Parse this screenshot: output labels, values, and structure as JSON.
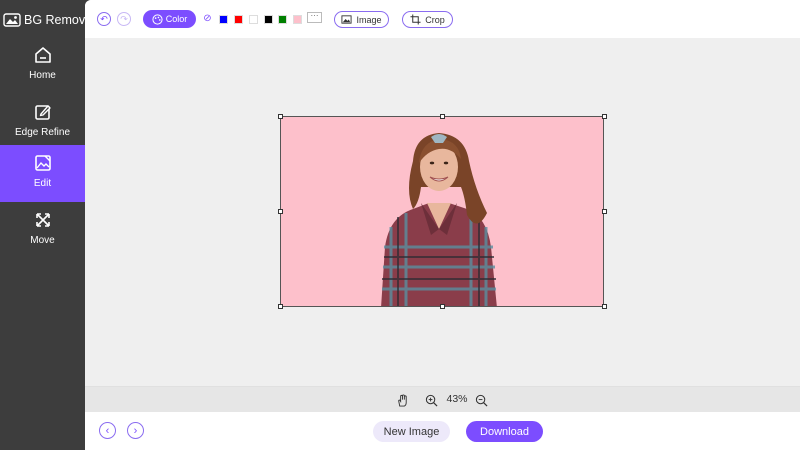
{
  "app": {
    "title": "BG Remover"
  },
  "sidebar": {
    "items": [
      {
        "label": "Home",
        "icon": "home-icon"
      },
      {
        "label": "Edge Refine",
        "icon": "edit-pencil-icon"
      },
      {
        "label": "Edit",
        "icon": "image-edit-icon",
        "active": true
      },
      {
        "label": "Move",
        "icon": "move-arrows-icon"
      }
    ]
  },
  "toolbar": {
    "undo_icon": "undo-icon",
    "redo_icon": "redo-icon",
    "color_label": "Color",
    "no_color_symbol": "⊘",
    "swatches": [
      "#0000ff",
      "#ff0000",
      "#ffffff",
      "#000000",
      "#008000",
      "#fdc0cb"
    ],
    "more_symbol": "···",
    "image_label": "Image",
    "crop_label": "Crop"
  },
  "canvas": {
    "background_color": "#fdc0cb"
  },
  "zoom": {
    "value": "43%"
  },
  "bottom": {
    "new_image_label": "New Image",
    "download_label": "Download"
  },
  "colors": {
    "accent": "#7c4dff",
    "sidebar": "#3d3d3d"
  }
}
